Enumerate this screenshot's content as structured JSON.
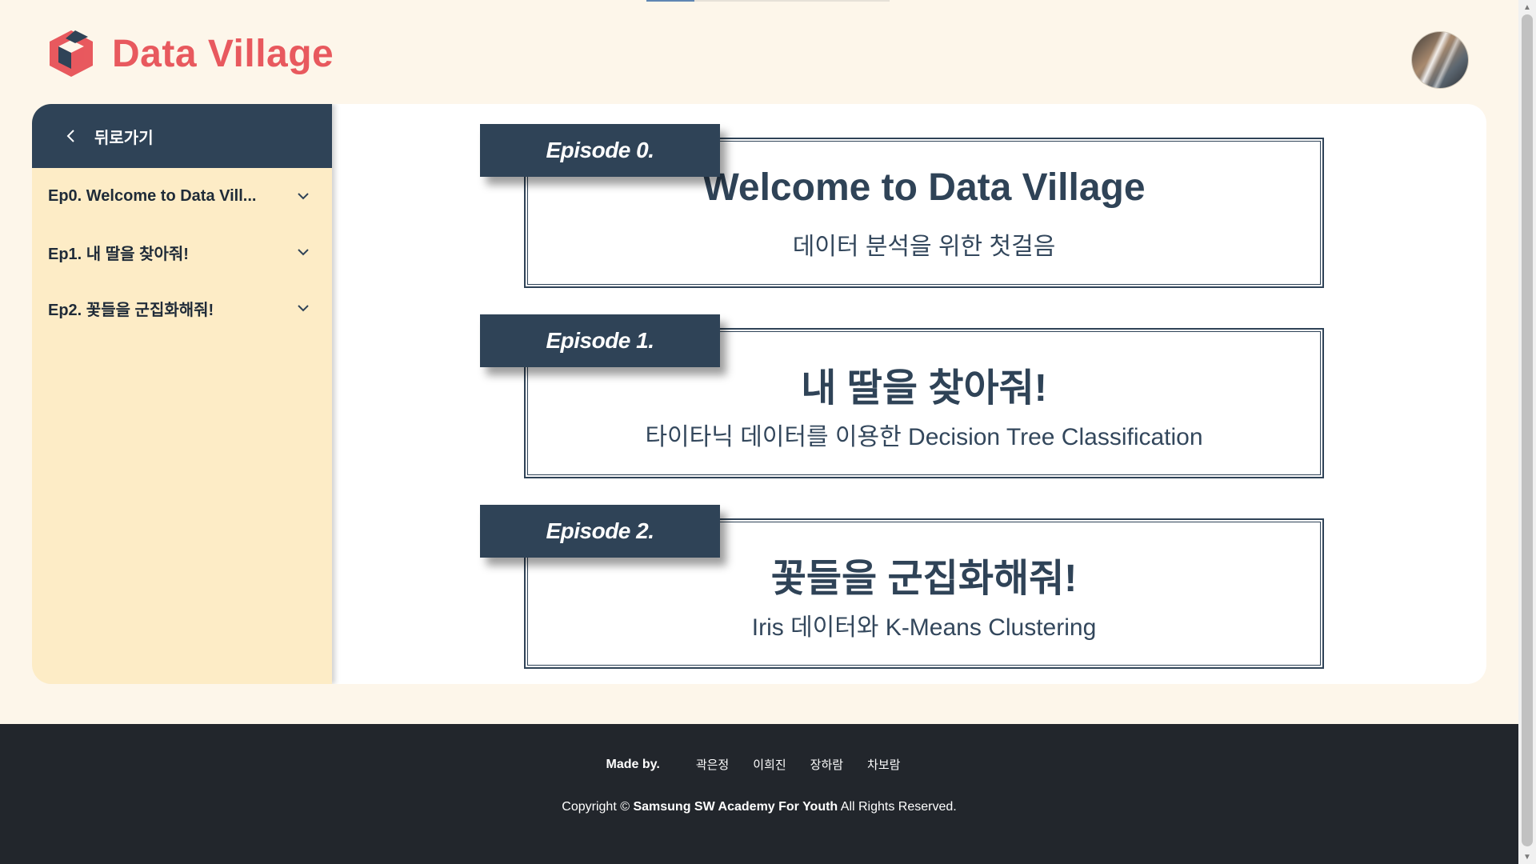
{
  "header": {
    "logo_text": "Data Village",
    "brand_color": "#e8595e"
  },
  "sidebar": {
    "back_label": "뒤로가기",
    "items": [
      {
        "label": "Ep0. Welcome to Data Vill..."
      },
      {
        "label": "Ep1. 내 딸을 찾아줘!"
      },
      {
        "label": "Ep2. 꽃들을 군집화해줘!"
      }
    ]
  },
  "episodes": [
    {
      "tag": "Episode 0.",
      "title": "Welcome to Data Village",
      "subtitle": "데이터 분석을 위한 첫걸음"
    },
    {
      "tag": "Episode 1.",
      "title": "내 딸을 찾아줘!",
      "subtitle": "타이타닉 데이터를 이용한 Decision Tree Classification"
    },
    {
      "tag": "Episode 2.",
      "title": "꽃들을 군집화해줘!",
      "subtitle": "Iris 데이터와 K-Means Clustering"
    }
  ],
  "footer": {
    "made_by": "Made by.",
    "members": [
      "곽은정",
      "이희진",
      "장하람",
      "차보람"
    ],
    "copyright_prefix": "Copyright ©",
    "copyright_org": "Samsung SW Academy For Youth",
    "copyright_suffix": "All Rights Reserved."
  },
  "colors": {
    "page_bg": "#fdf6ea",
    "navy": "#2f4357",
    "sidebar_bg": "#fdecc6",
    "footer_bg": "#22262c"
  }
}
